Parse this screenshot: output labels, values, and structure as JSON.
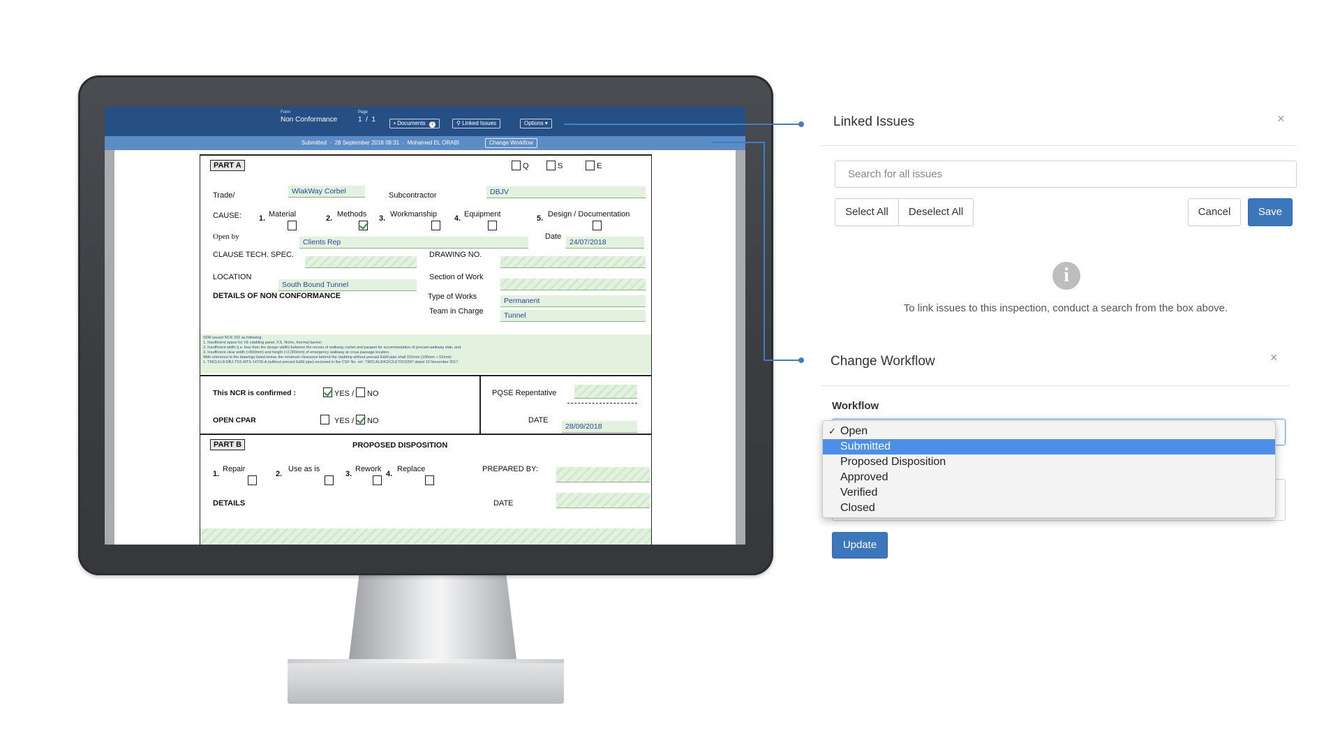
{
  "screen": {
    "toolbar": {
      "form_label": "Form",
      "form_value": "Non Conformance",
      "page_label": "Page",
      "page_value": "1  /  1",
      "documents_label": "Documents",
      "documents_count": "1",
      "linked_issues_label": "Linked Issues",
      "options_label": "Options ▾"
    },
    "status": {
      "text": "Submitted  ·  28 September 2018 08:31  ·  Mohamed EL ORABI",
      "change_workflow_label": "Change Workflow"
    }
  },
  "form": {
    "part_a_label": "PART A",
    "qse": [
      "Q",
      "S",
      "E"
    ],
    "trade_label": "Trade/",
    "trade_value": "WlakWay Corbel",
    "subcontractor_label": "Subcontractor",
    "subcontractor_value": "DBJV",
    "cause_label": "CAUSE:",
    "causes": [
      {
        "num": "1.",
        "label": "Material",
        "checked": false
      },
      {
        "num": "2.",
        "label": "Methods",
        "checked": true
      },
      {
        "num": "3.",
        "label": "Workmanship",
        "checked": false
      },
      {
        "num": "4.",
        "label": "Equipment",
        "checked": false
      },
      {
        "num": "5.",
        "label": "Design / Documentation",
        "checked": false
      }
    ],
    "open_by_label": "Open by",
    "open_by_value": "Clients Rep",
    "date_label": "Date",
    "date_value": "24/07/2018",
    "clause_label": "CLAUSE TECH. SPEC.",
    "drawing_label": "DRAWING NO.",
    "location_label": "LOCATION",
    "location_value": "South Bound Tunnel",
    "section_label": "Section of Work",
    "details_nc_label": "DETAILS OF NON CONFORMANCE",
    "type_works_label": "Type of Works",
    "type_works_value": "Permanent",
    "team_label": "Team in Charge",
    "team_value": "Tunnel",
    "description_lines": [
      "SDR issued NCR 202 as following:",
      "1. Insufficient space for VE cladding panel, F.S. Niche, thermal barrier;",
      "2. Insufficient width (i.e. less than the design width) between the recess of walkway corbel and parapet for accommodation of precast walkway slab, and",
      "3. Insufficient clear width (<800mm) and height (<2,000mm) of emergency walkway at cross passage location.",
      "With reference to the drawings listed below, the minimum clearance behind the cladding without precast E&M pipe shall 151mm (100mm + 51mm):",
      "1. TMCLKL8-DBJ-TSS-MTS-14729-A (without precast E&M pipe) enclosed in the CSF No. ref.: TMCLKL8/KDC/LET/015397 dated 10 November 2017."
    ],
    "ncr_confirmed_label": "This NCR is confirmed :",
    "yes_label": "YES /",
    "no_label": "NO",
    "pqse_label": "PQSE Repentative",
    "open_cpar_label": "OPEN CPAR",
    "date_caps_label": "DATE",
    "cpar_date_value": "28/09/2018",
    "part_b_label": "PART B",
    "proposed_disposition_label": "PROPOSED DISPOSITION",
    "dispositions": [
      {
        "num": "1.",
        "label": "Repair"
      },
      {
        "num": "2.",
        "label": "Use as is"
      },
      {
        "num": "3.",
        "label": "Rework"
      },
      {
        "num": "4.",
        "label": "Replace"
      }
    ],
    "prepared_by_label": "PREPARED BY:",
    "details_label": "DETAILS"
  },
  "linked_issues": {
    "title": "Linked Issues",
    "close_symbol": "×",
    "search_placeholder": "Search for all issues",
    "select_all_label": "Select All",
    "deselect_all_label": "Deselect All",
    "cancel_label": "Cancel",
    "save_label": "Save",
    "info_symbol": "i",
    "info_text": "To link issues to this inspection, conduct a search from the box above."
  },
  "change_workflow": {
    "title": "Change Workflow",
    "close_symbol": "×",
    "workflow_label": "Workflow",
    "check_symbol": "✓",
    "options": [
      "Open",
      "Submitted",
      "Proposed Disposition",
      "Approved",
      "Verified",
      "Closed"
    ],
    "checked_option": "Open",
    "highlighted_option": "Submitted",
    "update_label": "Update"
  },
  "colors": {
    "toolbar": "#264f86",
    "status_bar": "#5b8cc6",
    "accent": "#3d77bb",
    "connector": "#3d7ec7",
    "field_fill": "#e3f1df",
    "dropdown_highlight": "#4d8fe6"
  }
}
